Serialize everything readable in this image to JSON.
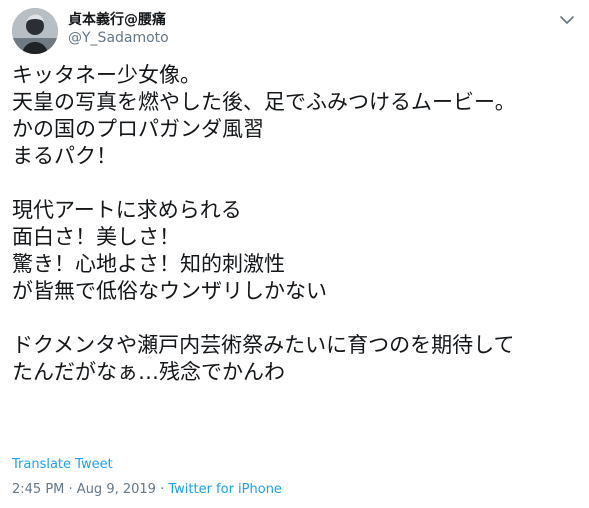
{
  "user": {
    "display_name": "貞本義行@腰痛",
    "handle": "@Y_Sadamoto",
    "avatar_icon": "avatar-photo"
  },
  "menu_icon": "chevron-down-icon",
  "tweet_lines": [
    "キッタネー少女像。",
    "天皇の写真を燃やした後、足でふみつけるムービー。",
    "かの国のプロパガンダ風習",
    "まるパク！",
    "",
    "現代アートに求められる",
    "面白さ！美しさ！",
    "驚き！心地よさ！知的刺激性",
    "が皆無で低俗なウンザリしかない",
    "",
    "ドクメンタや瀬戸内芸術祭みたいに育つのを期待して",
    "たんだがなぁ…残念でかんわ"
  ],
  "translate_label": "Translate Tweet",
  "meta": {
    "time": "2:45 PM",
    "separator": " · ",
    "date": "Aug 9, 2019",
    "source": "Twitter for iPhone"
  },
  "colors": {
    "link": "#1da1f2",
    "secondary": "#657786",
    "text": "#14171a"
  }
}
